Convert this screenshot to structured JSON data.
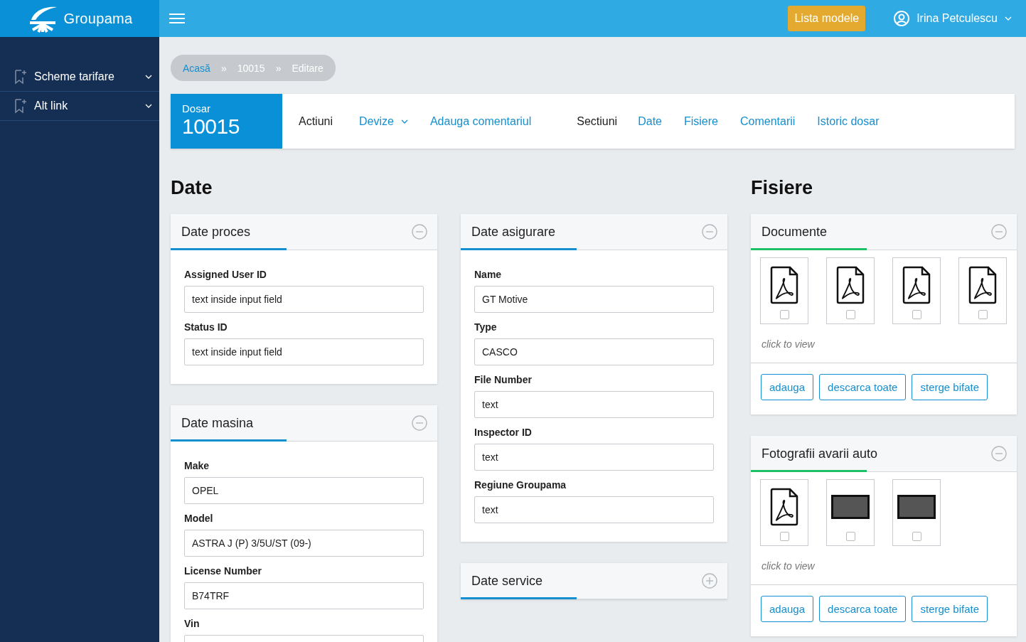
{
  "brand": {
    "name": "Groupama"
  },
  "topbar": {
    "button": "Lista modele",
    "user": "Irina Petculescu"
  },
  "sidebar": {
    "items": [
      {
        "label": "Scheme tarifare",
        "expanded": false
      },
      {
        "label": "Alt link",
        "expanded": false
      }
    ]
  },
  "breadcrumb": [
    {
      "label": "Acasă",
      "link": true
    },
    {
      "label": "»",
      "link": false
    },
    {
      "label": "10015",
      "link": false
    },
    {
      "label": "»",
      "link": false
    },
    {
      "label": "Editare",
      "link": false
    }
  ],
  "dosar": {
    "label": "Dosar",
    "number": "10015"
  },
  "nav": [
    {
      "kind": "label",
      "label": "Actiuni"
    },
    {
      "kind": "dropdown",
      "label": "Devize"
    },
    {
      "kind": "link",
      "label": "Adauga comentariul"
    },
    {
      "kind": "label",
      "label": "Sectiuni"
    },
    {
      "kind": "link",
      "label": "Date"
    },
    {
      "kind": "link",
      "label": "Fisiere"
    },
    {
      "kind": "link",
      "label": "Comentarii"
    },
    {
      "kind": "link",
      "label": "Istoric dosar"
    }
  ],
  "date_heading": "Date",
  "files_heading": "Fisiere",
  "columns": [
    [
      {
        "title": "Date proces",
        "expanded": true,
        "fields": [
          {
            "label": "Assigned User ID",
            "value": "text inside input field"
          },
          {
            "label": "Status ID",
            "value": "text inside input field"
          }
        ]
      },
      {
        "title": "Date masina",
        "expanded": true,
        "fields": [
          {
            "label": "Make",
            "value": "OPEL"
          },
          {
            "label": "Model",
            "value": "ASTRA J (P) 3/5U/ST (09-)"
          },
          {
            "label": "License Number",
            "value": "B74TRF"
          },
          {
            "label": "Vin"
          }
        ]
      }
    ],
    [
      {
        "title": "Date asigurare",
        "expanded": true,
        "fields": [
          {
            "label": "Name",
            "value": "GT Motive"
          },
          {
            "label": "Type",
            "value": "CASCO"
          },
          {
            "label": "File Number",
            "value": "text"
          },
          {
            "label": "Inspector ID",
            "value": "text"
          },
          {
            "label": "Regiune Groupama",
            "value": "text"
          }
        ]
      },
      {
        "title": "Date service",
        "expanded": false
      }
    ]
  ],
  "file_groups": [
    {
      "title": "Documente",
      "expanded": true,
      "hint": "click to view",
      "files": [
        {
          "kind": "pdf",
          "checked": false
        },
        {
          "kind": "pdf",
          "checked": false
        },
        {
          "kind": "pdf",
          "checked": false
        },
        {
          "kind": "pdf",
          "checked": false
        }
      ],
      "buttons": [
        "adauga",
        "descarca toate",
        "sterge bifate"
      ]
    },
    {
      "title": "Fotografii avarii auto",
      "expanded": true,
      "hint": "click to view",
      "files": [
        {
          "kind": "pdf",
          "checked": false
        },
        {
          "kind": "photo",
          "checked": false
        },
        {
          "kind": "photo",
          "checked": false
        }
      ],
      "buttons": [
        "adauga",
        "descarca toate",
        "sterge bifate"
      ]
    }
  ]
}
